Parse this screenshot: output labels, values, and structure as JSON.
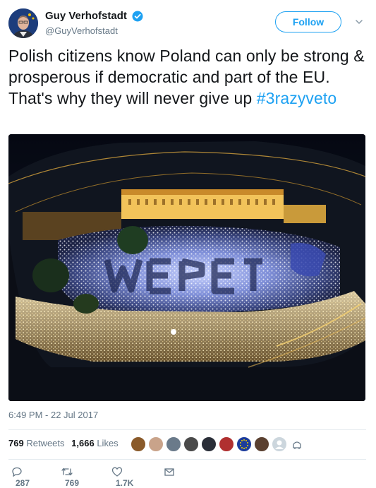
{
  "author": {
    "name": "Guy Verhofstadt",
    "handle": "@GuyVerhofstadt",
    "follow_label": "Follow"
  },
  "tweet": {
    "text": "Polish citizens know Poland can only be strong & prosperous if democratic and part of the EU. That's why they will never give up ",
    "hashtag": "#3razyveto",
    "timestamp": "6:49 PM - 22 Jul 2017"
  },
  "stats": {
    "retweets_count": "769",
    "retweets_label": "Retweets",
    "likes_count": "1,666",
    "likes_label": "Likes"
  },
  "actions": {
    "reply_count": "287",
    "retweet_count": "769",
    "like_count": "1.7K"
  },
  "colors": {
    "accent": "#1da1f2",
    "secondary_text": "#657786"
  },
  "icons": [
    "verified-badge-icon",
    "chevron-down-icon",
    "reply-icon",
    "retweet-icon",
    "heart-icon",
    "message-icon"
  ]
}
